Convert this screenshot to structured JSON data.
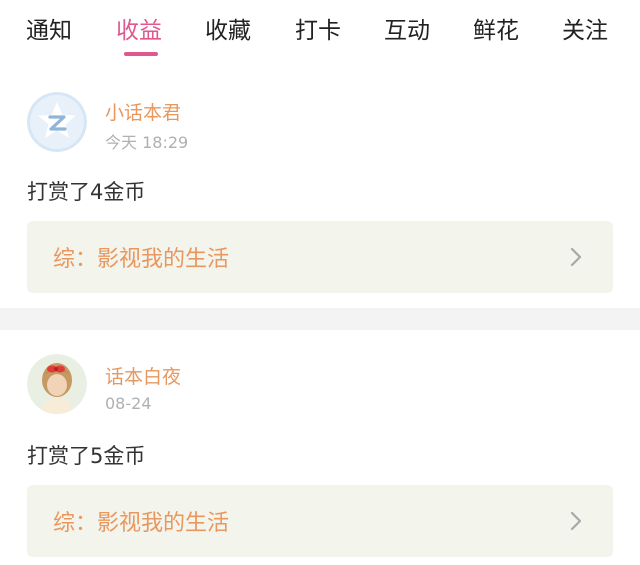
{
  "tabs": [
    {
      "label": "通知"
    },
    {
      "label": "收益"
    },
    {
      "label": "收藏"
    },
    {
      "label": "打卡"
    },
    {
      "label": "互动"
    },
    {
      "label": "鲜花"
    },
    {
      "label": "关注"
    }
  ],
  "active_tab": "收益",
  "colors": {
    "accent": "#e0588e",
    "username": "#e8975f",
    "link_bg": "#f3f4ec"
  },
  "feed": [
    {
      "user": "小话本君",
      "time": "今天 18:29",
      "message": "打赏了4金币",
      "link_text": "综：影视我的生活",
      "avatar_icon": "blue-z-badge-icon"
    },
    {
      "user": "话本白夜",
      "time": "08-24",
      "message": "打赏了5金币",
      "link_text": "综：影视我的生活",
      "avatar_icon": "user-photo"
    }
  ]
}
